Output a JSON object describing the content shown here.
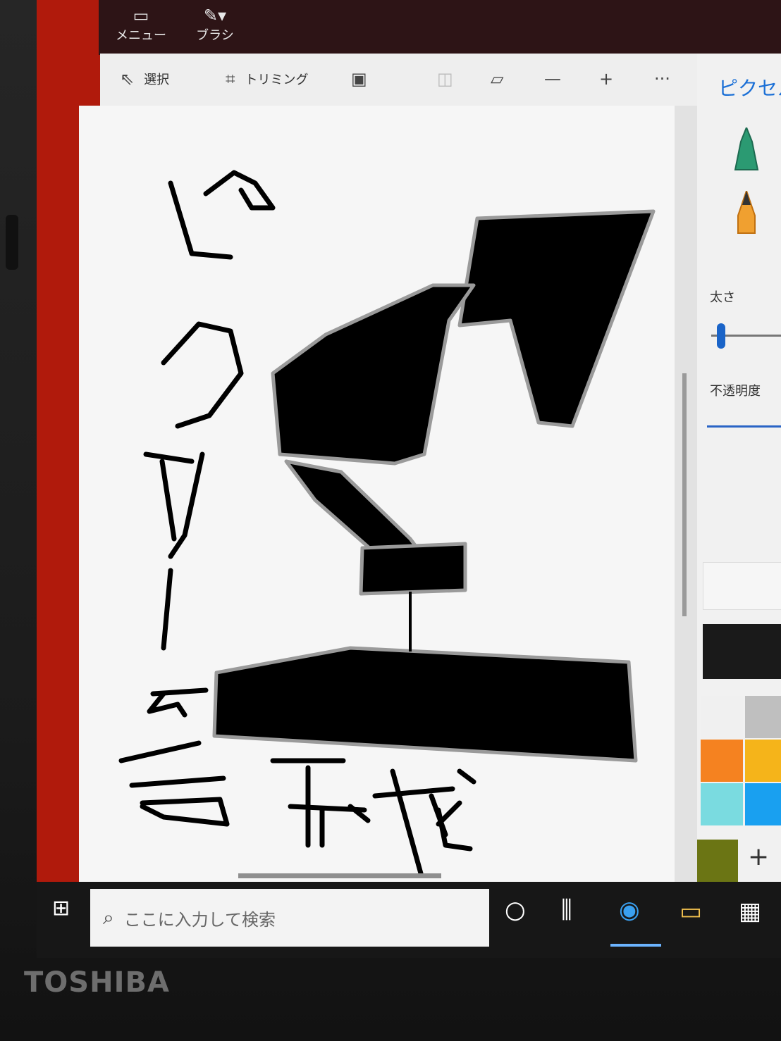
{
  "app": {
    "title_buttons": [
      {
        "label": "メニュー",
        "icon": "folder-icon"
      },
      {
        "label": "ブラシ",
        "icon": "brush-icon"
      }
    ]
  },
  "toolbar": {
    "select_label": "選択",
    "crop_label": "トリミング"
  },
  "panel": {
    "title": "ピクセル",
    "thickness_label": "太さ",
    "opacity_label": "不透明度",
    "add_color_label": "+",
    "colors": [
      "#1a1a1a",
      "#f0f0f0",
      "#bfbfbf",
      "#f58220",
      "#f5b41a",
      "#7adbe0",
      "#19a0f0",
      "#6b7514"
    ]
  },
  "canvas": {
    "ink_color": "#000000"
  },
  "taskbar": {
    "search_placeholder": "ここに入力して検索"
  },
  "device": {
    "brand": "TOSHIBA"
  },
  "colors": {
    "screen_border": "#b01a0c",
    "accent": "#1a6fd6"
  }
}
